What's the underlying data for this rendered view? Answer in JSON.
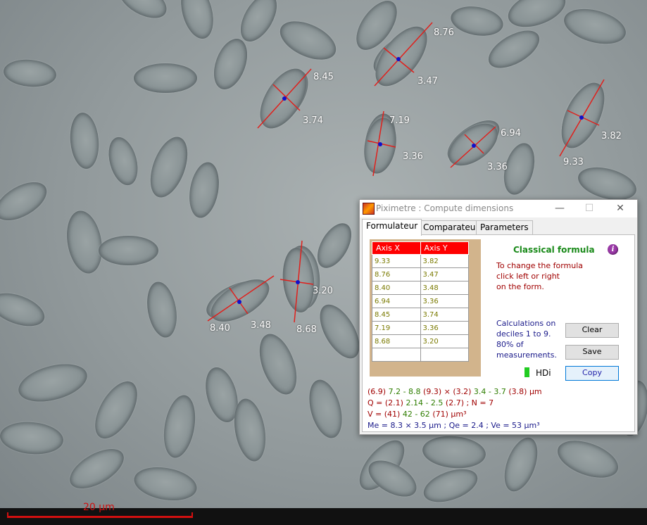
{
  "window": {
    "title": "Piximetre : Compute dimensions",
    "minimize_glyph": "—",
    "maximize_glyph": "☐",
    "close_glyph": "✕"
  },
  "tabs": [
    {
      "label": "Formulateur",
      "active": true
    },
    {
      "label": "Comparateur",
      "active": false
    },
    {
      "label": "Parameters",
      "active": false
    }
  ],
  "table": {
    "headers": [
      "Axis X",
      "Axis Y"
    ],
    "rows": [
      [
        "9.33",
        "3.82"
      ],
      [
        "8.76",
        "3.47"
      ],
      [
        "8.40",
        "3.48"
      ],
      [
        "6.94",
        "3.36"
      ],
      [
        "8.45",
        "3.74"
      ],
      [
        "7.19",
        "3.36"
      ],
      [
        "8.68",
        "3.20"
      ],
      [
        "",
        ""
      ]
    ]
  },
  "formula": {
    "title": "Classical formula",
    "info_glyph": "i",
    "hint_lines": [
      "To change the formula",
      "click left or right",
      "on the form."
    ],
    "calc_lines": [
      "Calculations on",
      "deciles 1 to 9.",
      "80% of",
      "measurements."
    ]
  },
  "buttons": {
    "clear": "Clear",
    "save": "Save",
    "copy": "Copy"
  },
  "hdi_label": "HDi",
  "results": {
    "size": {
      "min_p": "(6.9)",
      "range_x": "7.2 - 8.8",
      "max_p": "(9.3)",
      "times": "×",
      "min_p2": "(3.2)",
      "range_y": "3.4 - 3.7",
      "max_p2": "(3.8)",
      "unit": "µm"
    },
    "q": {
      "label": "Q = ",
      "min_p": "(2.1)",
      "range": "2.14 - 2.5",
      "max_p": "(2.7)",
      "n": "; N = 7"
    },
    "v": {
      "label": "V = ",
      "min_p": "(41)",
      "range": "42 - 62",
      "max_p": "(71)",
      "unit": "µm³"
    },
    "means": "Me = 8.3 × 3.5 µm ; Qe = 2.4 ; Ve = 53 µm³"
  },
  "measurements": [
    "8.76",
    "3.47",
    "8.45",
    "3.74",
    "7.19",
    "3.36",
    "6.94",
    "3.36",
    "3.82",
    "9.33",
    "3.20",
    "8.40",
    "3.48",
    "8.68"
  ],
  "scale_bar": {
    "label": "20 µm"
  },
  "colors": {
    "measure_line": "#e0201c",
    "center_dot": "#1010cc",
    "table_header": "#ff0000",
    "formula_title": "#1a8a1a"
  }
}
